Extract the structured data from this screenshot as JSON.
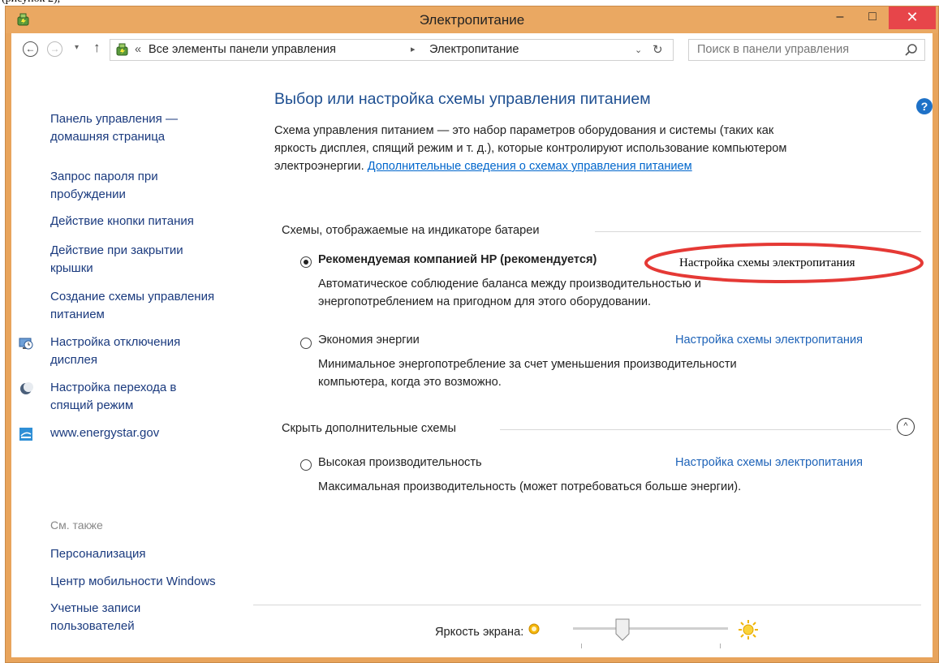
{
  "window": {
    "title": "Электропитание",
    "min_glyph": "–",
    "max_glyph": "□",
    "close_glyph": "✕"
  },
  "address_bar": {
    "back_glyph": "←",
    "forward_glyph": "→",
    "recent_glyph": "▾",
    "up_glyph": "↑",
    "crumb_prefix": "«",
    "crumbs": [
      "Все элементы панели управления",
      "Электропитание"
    ],
    "crumb_separator": "▸",
    "dropdown_glyph": "⌄",
    "refresh_glyph": "↻",
    "search_placeholder": "Поиск в панели управления"
  },
  "help_glyph": "?",
  "sidebar": {
    "home_link": [
      "Панель управления —",
      "домашняя страница"
    ],
    "links": [
      [
        "Запрос пароля при",
        "пробуждении"
      ],
      [
        "Действие кнопки питания"
      ],
      [
        "Действие при закрытии",
        "крышки"
      ],
      [
        "Создание схемы управления",
        "питанием"
      ]
    ],
    "icon_links": [
      {
        "lines": [
          "Настройка отключения",
          "дисплея"
        ],
        "icon": "monitor-clock-icon"
      },
      {
        "lines": [
          "Настройка перехода в",
          "спящий режим"
        ],
        "icon": "moon-icon"
      },
      {
        "lines": [
          "www.energystar.gov"
        ],
        "icon": "energy-star-icon"
      }
    ],
    "see_also_label": "См. также",
    "see_also": [
      [
        "Персонализация"
      ],
      [
        "Центр мобильности Windows"
      ],
      [
        "Учетные записи",
        "пользователей"
      ]
    ]
  },
  "main": {
    "heading": "Выбор или настройка схемы управления питанием",
    "description_lines": [
      "Схема управления питанием — это набор параметров оборудования и системы (таких как",
      "яркость дисплея, спящий режим и т. д.), которые контролируют использование компьютером",
      "электроэнергии."
    ],
    "description_link": "Дополнительные сведения о схемах управления питанием",
    "battery_group_label": "Схемы, отображаемые на индикаторе батареи",
    "hidden_group_label": "Скрыть дополнительные схемы",
    "collapse_glyph": "^",
    "plans": [
      {
        "name": "Рекомендуемая компанией HP (рекомендуется)",
        "selected": true,
        "desc": [
          "Автоматическое соблюдение баланса между производительностью и",
          "энергопотреблением на пригодном для этого оборудовании."
        ],
        "settings_link": "Настройка схемы электропитания"
      },
      {
        "name": "Экономия энергии",
        "selected": false,
        "desc": [
          "Минимальное энергопотребление за счет уменьшения производительности",
          "компьютера, когда это возможно."
        ],
        "settings_link": "Настройка схемы электропитания"
      },
      {
        "name": "Высокая производительность",
        "selected": false,
        "desc": [
          "Максимальная производительность (может потребоваться больше энергии)."
        ],
        "settings_link": "Настройка схемы электропитания"
      }
    ]
  },
  "brightness": {
    "label": "Яркость экрана:",
    "level_fraction": 0.33
  },
  "annotation": {
    "text": "Настройка схемы электропитания",
    "color": "#e53935"
  },
  "colors": {
    "title_bar": "#eaa862",
    "close_button": "#e7454a",
    "heading": "#1e4f91",
    "link": "#1e63b8"
  }
}
